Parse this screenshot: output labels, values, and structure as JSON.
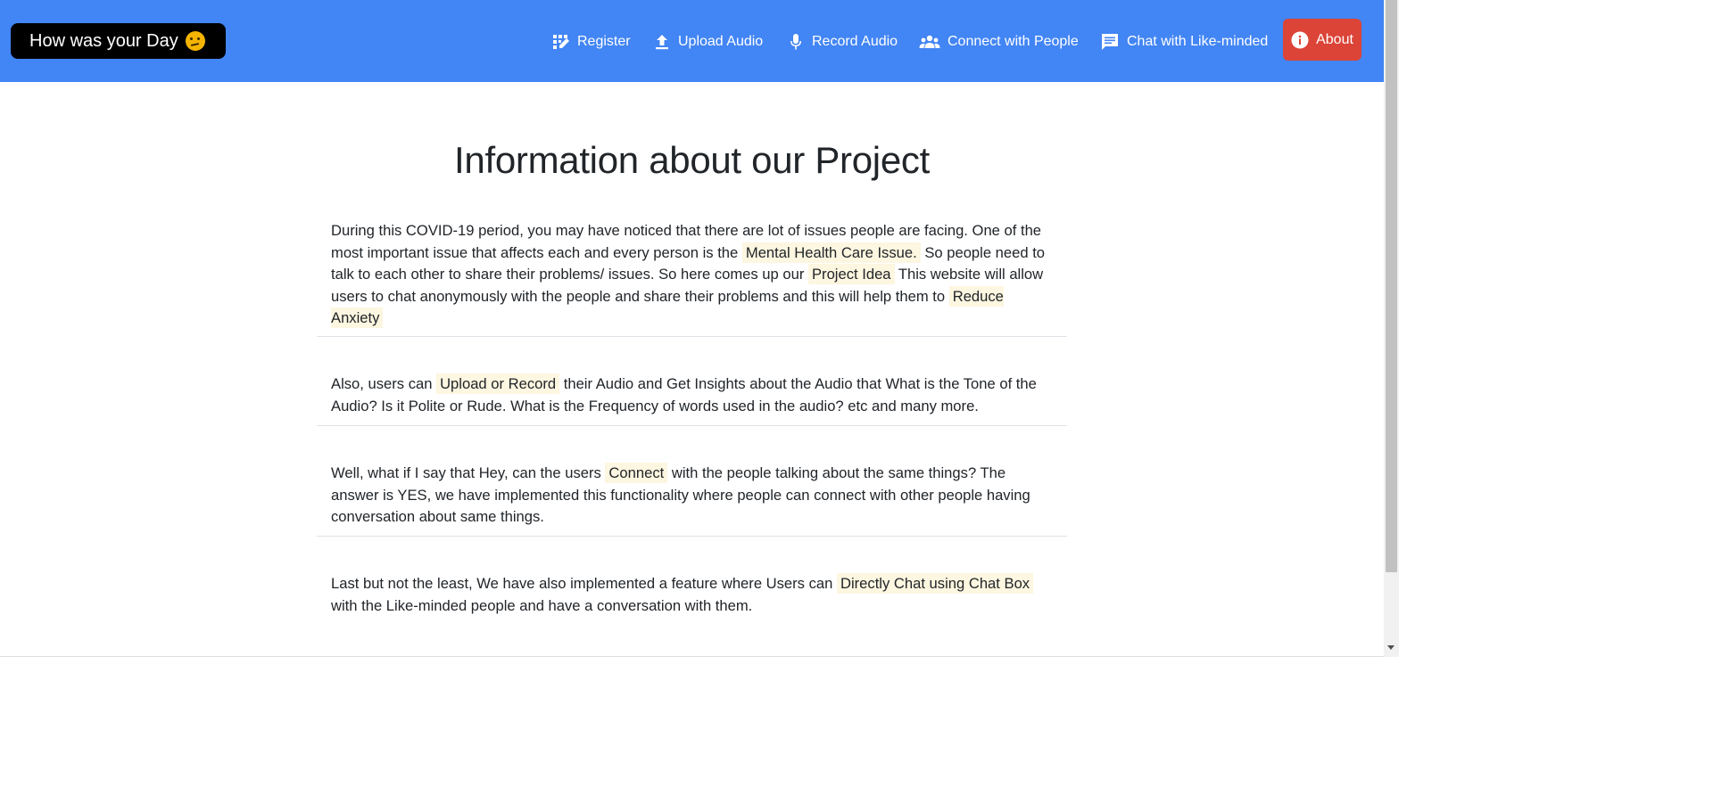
{
  "brand": {
    "label": "How was your Day",
    "emoji_icon": "thinking-face-emoji"
  },
  "nav": {
    "register": "Register",
    "upload_audio": "Upload Audio",
    "record_audio": "Record Audio",
    "connect": "Connect with People",
    "chat": "Chat with Like-minded",
    "about": "About"
  },
  "colors": {
    "navbar": "#4285f4",
    "about_button": "#db4437",
    "highlight": "#fdf6e0"
  },
  "main": {
    "title": "Information about our Project",
    "p1": {
      "t1": "During this COVID-19 period, you may have noticed that there are lot of issues people are facing. One of the most important issue that affects each and every person is the ",
      "h1": "Mental Health Care Issue.",
      "t2": " So people need to talk to each other to share their problems/ issues. So here comes up our ",
      "h2": "Project Idea",
      "t3": " This website will allow users to chat anonymously with the people and share their problems and this will help them to ",
      "h3": "Reduce Anxiety"
    },
    "p2": {
      "t1": "Also, users can ",
      "h1": "Upload or Record",
      "t2": " their Audio and Get Insights about the Audio that What is the Tone of the Audio? Is it Polite or Rude. What is the Frequency of words used in the audio? etc and many more."
    },
    "p3": {
      "t1": "Well, what if I say that Hey, can the users ",
      "h1": "Connect",
      "t2": " with the people talking about the same things? The answer is YES, we have implemented this functionality where people can connect with other people having conversation about same things."
    },
    "p4": {
      "t1": "Last but not the least, We have also implemented a feature where Users can ",
      "h1": "Directly Chat using Chat Box",
      "t2": " with the Like-minded people and have a conversation with them."
    }
  }
}
